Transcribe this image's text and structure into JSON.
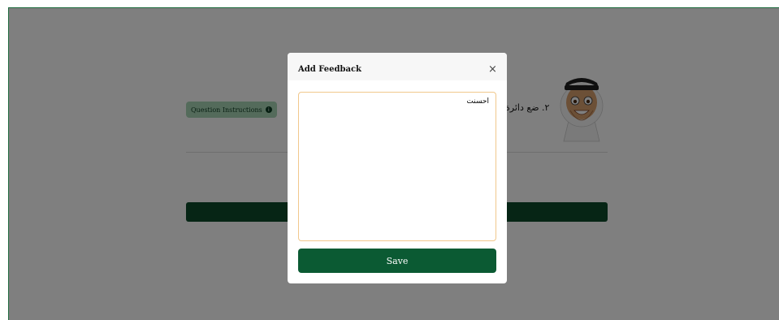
{
  "background": {
    "instructions_label": "Question Instructions",
    "instructions_icon": "info-icon",
    "question_text": "٢. ضع دائرة",
    "avatar_icon": "boy-avatar"
  },
  "modal": {
    "title": "Add Feedback",
    "close_label": "×",
    "feedback_value": "احسنت",
    "save_label": "Save"
  },
  "colors": {
    "brand_green": "#0b5a33",
    "instructions_bg": "#a9d6b6",
    "textarea_border": "#f1c88c",
    "overlay": "rgba(0,0,0,0.5)"
  }
}
